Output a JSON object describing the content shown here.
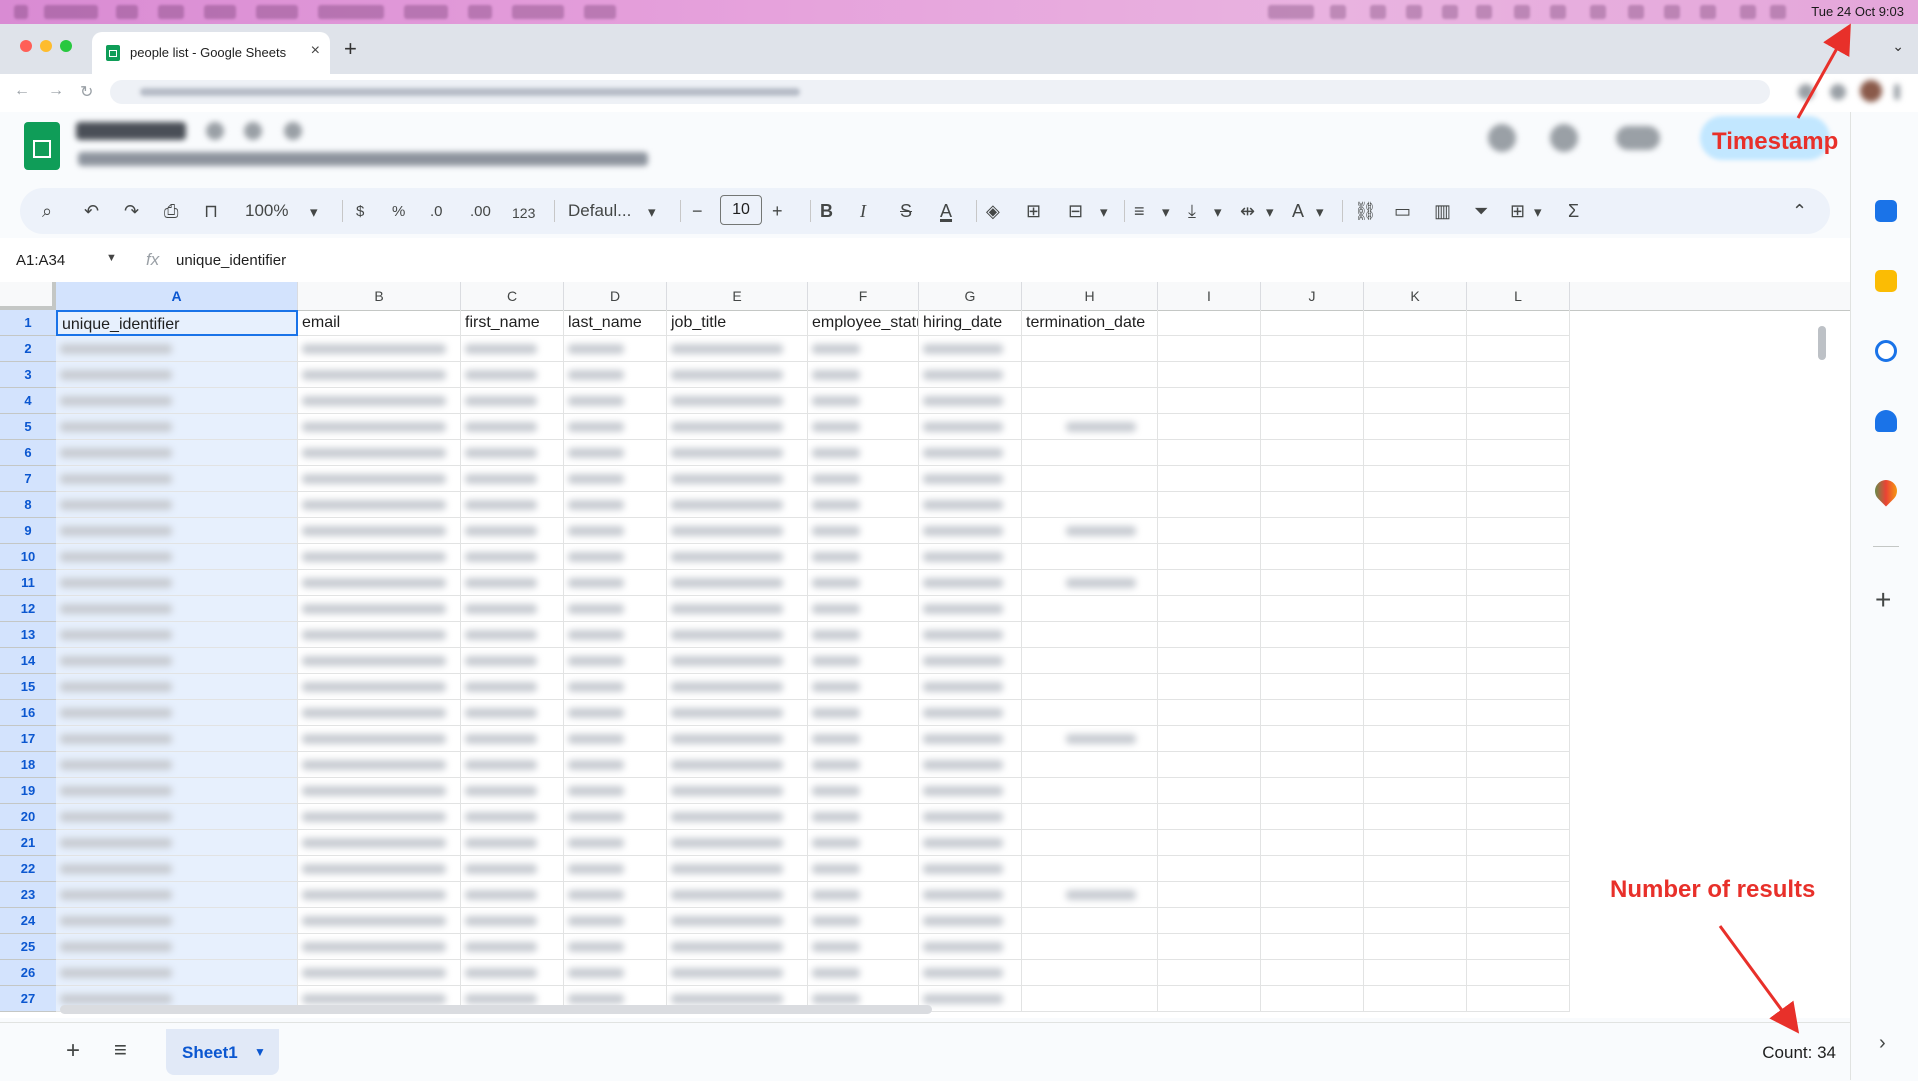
{
  "menubar": {
    "clock": "Tue 24 Oct  9:03"
  },
  "browser": {
    "tab_title": "people list - Google Sheets",
    "tab_close": "×",
    "new_tab": "+",
    "tab_list": "⌄"
  },
  "toolbar": {
    "zoom": "100%",
    "currency": "$",
    "percent": "%",
    "decrease_decimal": ".0",
    "increase_decimal": ".00",
    "number_format": "123",
    "font": "Defaul...",
    "font_size": "10",
    "bold": "B",
    "italic": "I",
    "strike": "S",
    "text_color": "A",
    "function": "Σ"
  },
  "formula_bar": {
    "name_box": "A1:A34",
    "fx": "fx",
    "formula": "unique_identifier"
  },
  "columns": [
    "A",
    "B",
    "C",
    "D",
    "E",
    "F",
    "G",
    "H",
    "I",
    "J",
    "K",
    "L"
  ],
  "headers": [
    "unique_identifier",
    "email",
    "first_name",
    "last_name",
    "job_title",
    "employee_status",
    "hiring_date",
    "termination_date"
  ],
  "rows": [
    {
      "n": "1"
    },
    {
      "n": "2"
    },
    {
      "n": "3"
    },
    {
      "n": "4"
    },
    {
      "n": "5"
    },
    {
      "n": "6"
    },
    {
      "n": "7"
    },
    {
      "n": "8"
    },
    {
      "n": "9"
    },
    {
      "n": "10"
    },
    {
      "n": "11"
    },
    {
      "n": "12"
    },
    {
      "n": "13"
    },
    {
      "n": "14"
    },
    {
      "n": "15"
    },
    {
      "n": "16"
    },
    {
      "n": "17"
    },
    {
      "n": "18"
    },
    {
      "n": "19"
    },
    {
      "n": "20"
    },
    {
      "n": "21"
    },
    {
      "n": "22"
    },
    {
      "n": "23"
    },
    {
      "n": "24"
    },
    {
      "n": "25"
    },
    {
      "n": "26"
    },
    {
      "n": "27"
    }
  ],
  "bottom": {
    "add_sheet": "+",
    "all_sheets": "≡",
    "sheet_name": "Sheet1",
    "count": "Count: 34"
  },
  "annotations": {
    "timestamp": "Timestamp",
    "results": "Number of results"
  },
  "colors": {
    "selection": "#d3e3fd",
    "accent": "#0b57d0",
    "annotation": "#e8302a"
  }
}
